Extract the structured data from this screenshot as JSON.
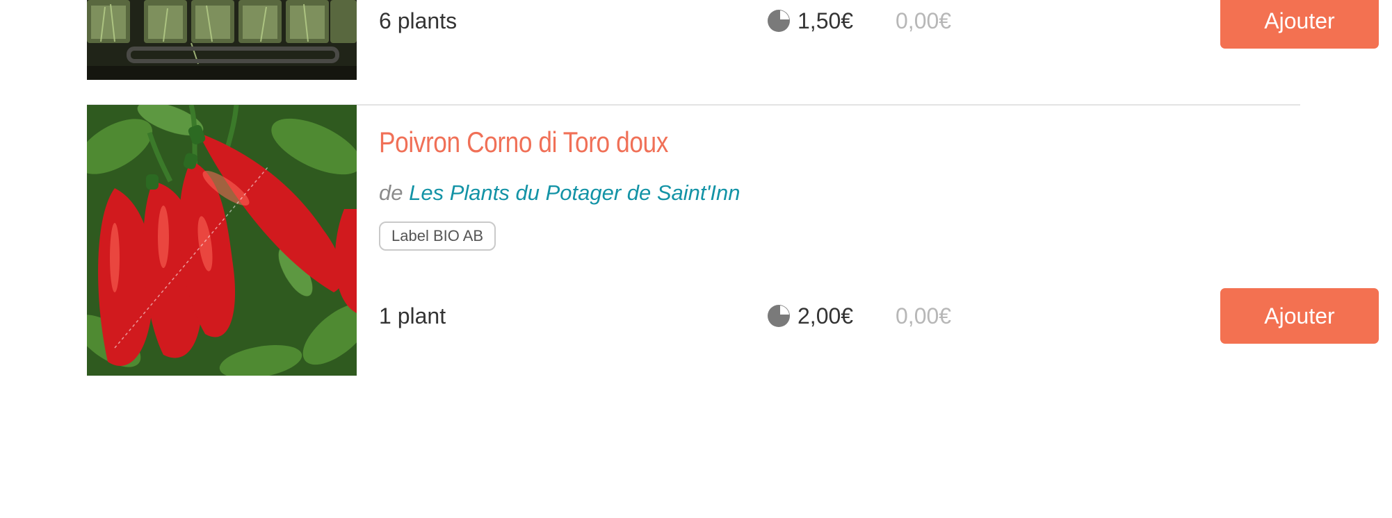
{
  "colors": {
    "accent": "#f37151",
    "title": "#f07057",
    "producer_link": "#1393a6",
    "muted_price": "#b7b7b7"
  },
  "products": [
    {
      "image_alt": "",
      "offer": {
        "quantity": "6 plants",
        "price_icon": "pie-chart-icon",
        "price": "1,50€",
        "total": "0,00€",
        "add_label": "Ajouter"
      }
    },
    {
      "name": "Poivron Corno di Toro doux",
      "producer_prefix": "de",
      "producer": "Les Plants du Potager de Saint'Inn",
      "image_alt": "",
      "badge": "Label BIO AB",
      "offer": {
        "quantity": "1 plant",
        "price_icon": "pie-chart-icon",
        "price": "2,00€",
        "total": "0,00€",
        "add_label": "Ajouter"
      }
    }
  ]
}
